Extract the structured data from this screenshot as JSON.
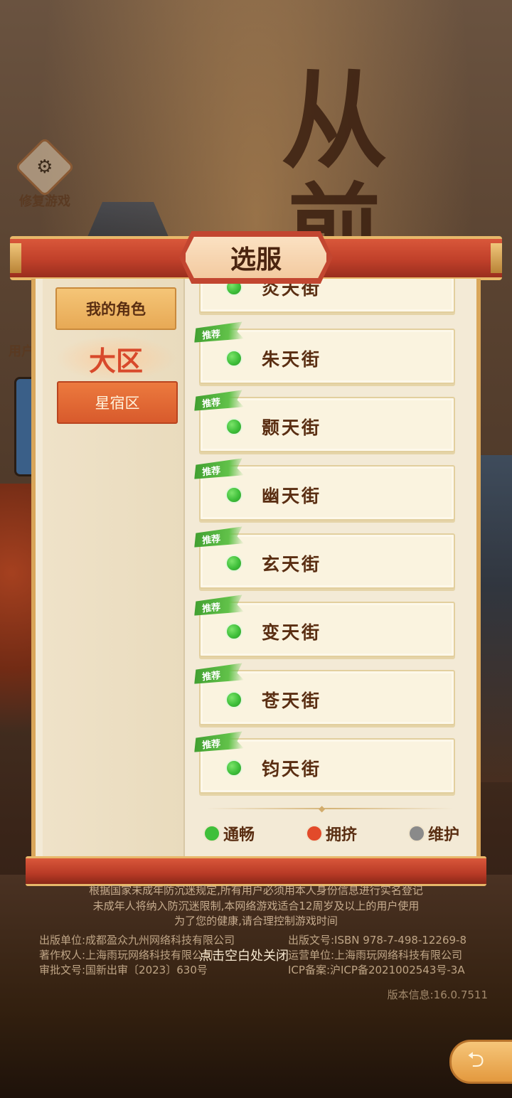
{
  "side": {
    "repair_label": "修复游戏",
    "repair_icon": "gear-icon",
    "user_label_partial": "用户"
  },
  "calligraphy": {
    "char1": "从",
    "char2": "前"
  },
  "modal": {
    "title": "选服",
    "tab_mine": "我的角色",
    "region_heading": "大区",
    "tab_region": "星宿区",
    "servers": [
      {
        "name": "炎天街",
        "status": "smooth",
        "recommended": false
      },
      {
        "name": "朱天街",
        "status": "smooth",
        "recommended": true
      },
      {
        "name": "颢天街",
        "status": "smooth",
        "recommended": true
      },
      {
        "name": "幽天街",
        "status": "smooth",
        "recommended": true
      },
      {
        "name": "玄天街",
        "status": "smooth",
        "recommended": true
      },
      {
        "name": "变天街",
        "status": "smooth",
        "recommended": true
      },
      {
        "name": "苍天街",
        "status": "smooth",
        "recommended": true
      },
      {
        "name": "钧天街",
        "status": "smooth",
        "recommended": true
      }
    ],
    "recommend_label": "推荐",
    "legend": {
      "smooth": "通畅",
      "crowded": "拥挤",
      "maintenance": "维护"
    }
  },
  "colors": {
    "smooth": "#3fbf3a",
    "crowded": "#e24a2a",
    "maintenance": "#8a8a8a"
  },
  "footer": {
    "legal_1": "根据国家未成年防沉迷规定,所有用户必须用本人身份信息进行实名登记",
    "legal_2": "未成年人将纳入防沉迷限制,本网络游戏适合12周岁及以上的用户使用",
    "legal_3": "为了您的健康,请合理控制游戏时间",
    "publisher": "出版单位:成都盈众九州网络科技有限公司",
    "copyright": "著作权人:上海雨玩网络科技有限公司",
    "approval": "审批文号:国新出审〔2023〕630号",
    "isbn": "出版文号:ISBN 978-7-498-12269-8",
    "operator": "运营单位:上海雨玩网络科技有限公司",
    "icp": "ICP备案:沪ICP备2021002543号-3A",
    "close_hint": "点击空白处关闭",
    "version": "版本信息:16.0.7511"
  }
}
